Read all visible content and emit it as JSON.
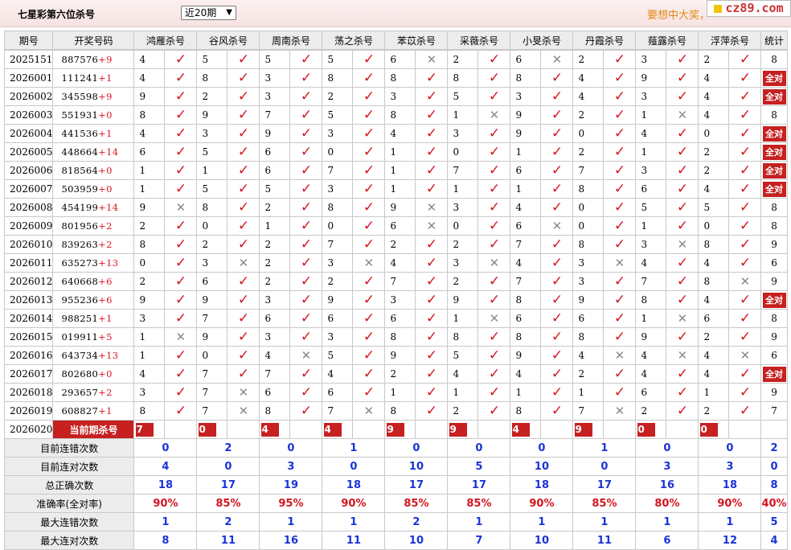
{
  "header": {
    "title": "七星彩第六位杀号",
    "period_select": "近20期",
    "marquee_text": "要想中大奖，",
    "logo_text": "cz89.com"
  },
  "columns": [
    "期号",
    "开奖号码",
    "鸿雁杀号",
    "谷风杀号",
    "周南杀号",
    "荡之杀号",
    "苯苡杀号",
    "采薇杀号",
    "小旻杀号",
    "丹霞杀号",
    "薤露杀号",
    "浮萍杀号",
    "统计"
  ],
  "rows": [
    {
      "no": "2025151",
      "num": "887576",
      "plus": "+9",
      "k": [
        [
          "4",
          1
        ],
        [
          "5",
          1
        ],
        [
          "5",
          1
        ],
        [
          "5",
          1
        ],
        [
          "6",
          0
        ],
        [
          "2",
          1
        ],
        [
          "6",
          0
        ],
        [
          "2",
          1
        ],
        [
          "3",
          1
        ],
        [
          "2",
          1
        ]
      ],
      "stat": "8"
    },
    {
      "no": "2026001",
      "num": "111241",
      "plus": "+1",
      "k": [
        [
          "4",
          1
        ],
        [
          "8",
          1
        ],
        [
          "3",
          1
        ],
        [
          "8",
          1
        ],
        [
          "8",
          1
        ],
        [
          "8",
          1
        ],
        [
          "8",
          1
        ],
        [
          "4",
          1
        ],
        [
          "9",
          1
        ],
        [
          "4",
          1
        ]
      ],
      "stat": "全对"
    },
    {
      "no": "2026002",
      "num": "345598",
      "plus": "+9",
      "k": [
        [
          "9",
          1
        ],
        [
          "2",
          1
        ],
        [
          "3",
          1
        ],
        [
          "2",
          1
        ],
        [
          "3",
          1
        ],
        [
          "5",
          1
        ],
        [
          "3",
          1
        ],
        [
          "4",
          1
        ],
        [
          "3",
          1
        ],
        [
          "4",
          1
        ]
      ],
      "stat": "全对"
    },
    {
      "no": "2026003",
      "num": "551931",
      "plus": "+0",
      "k": [
        [
          "8",
          1
        ],
        [
          "9",
          1
        ],
        [
          "7",
          1
        ],
        [
          "5",
          1
        ],
        [
          "8",
          1
        ],
        [
          "1",
          0
        ],
        [
          "9",
          1
        ],
        [
          "2",
          1
        ],
        [
          "1",
          0
        ],
        [
          "4",
          1
        ]
      ],
      "stat": "8"
    },
    {
      "no": "2026004",
      "num": "441536",
      "plus": "+1",
      "k": [
        [
          "4",
          1
        ],
        [
          "3",
          1
        ],
        [
          "9",
          1
        ],
        [
          "3",
          1
        ],
        [
          "4",
          1
        ],
        [
          "3",
          1
        ],
        [
          "9",
          1
        ],
        [
          "0",
          1
        ],
        [
          "4",
          1
        ],
        [
          "0",
          1
        ]
      ],
      "stat": "全对"
    },
    {
      "no": "2026005",
      "num": "448664",
      "plus": "+14",
      "k": [
        [
          "6",
          1
        ],
        [
          "5",
          1
        ],
        [
          "6",
          1
        ],
        [
          "0",
          1
        ],
        [
          "1",
          1
        ],
        [
          "0",
          1
        ],
        [
          "1",
          1
        ],
        [
          "2",
          1
        ],
        [
          "1",
          1
        ],
        [
          "2",
          1
        ]
      ],
      "stat": "全对"
    },
    {
      "no": "2026006",
      "num": "818564",
      "plus": "+0",
      "k": [
        [
          "1",
          1
        ],
        [
          "1",
          1
        ],
        [
          "6",
          1
        ],
        [
          "7",
          1
        ],
        [
          "1",
          1
        ],
        [
          "7",
          1
        ],
        [
          "6",
          1
        ],
        [
          "7",
          1
        ],
        [
          "3",
          1
        ],
        [
          "2",
          1
        ]
      ],
      "stat": "全对"
    },
    {
      "no": "2026007",
      "num": "503959",
      "plus": "+0",
      "k": [
        [
          "1",
          1
        ],
        [
          "5",
          1
        ],
        [
          "5",
          1
        ],
        [
          "3",
          1
        ],
        [
          "1",
          1
        ],
        [
          "1",
          1
        ],
        [
          "1",
          1
        ],
        [
          "8",
          1
        ],
        [
          "6",
          1
        ],
        [
          "4",
          1
        ]
      ],
      "stat": "全对"
    },
    {
      "no": "2026008",
      "num": "454199",
      "plus": "+14",
      "k": [
        [
          "9",
          0
        ],
        [
          "8",
          1
        ],
        [
          "2",
          1
        ],
        [
          "8",
          1
        ],
        [
          "9",
          0
        ],
        [
          "3",
          1
        ],
        [
          "4",
          1
        ],
        [
          "0",
          1
        ],
        [
          "5",
          1
        ],
        [
          "5",
          1
        ]
      ],
      "stat": "8"
    },
    {
      "no": "2026009",
      "num": "801956",
      "plus": "+2",
      "k": [
        [
          "2",
          1
        ],
        [
          "0",
          1
        ],
        [
          "1",
          1
        ],
        [
          "0",
          1
        ],
        [
          "6",
          0
        ],
        [
          "0",
          1
        ],
        [
          "6",
          0
        ],
        [
          "0",
          1
        ],
        [
          "1",
          1
        ],
        [
          "0",
          1
        ]
      ],
      "stat": "8"
    },
    {
      "no": "2026010",
      "num": "839263",
      "plus": "+2",
      "k": [
        [
          "8",
          1
        ],
        [
          "2",
          1
        ],
        [
          "2",
          1
        ],
        [
          "7",
          1
        ],
        [
          "2",
          1
        ],
        [
          "2",
          1
        ],
        [
          "7",
          1
        ],
        [
          "8",
          1
        ],
        [
          "3",
          0
        ],
        [
          "8",
          1
        ]
      ],
      "stat": "9"
    },
    {
      "no": "2026011",
      "num": "635273",
      "plus": "+13",
      "k": [
        [
          "0",
          1
        ],
        [
          "3",
          0
        ],
        [
          "2",
          1
        ],
        [
          "3",
          0
        ],
        [
          "4",
          1
        ],
        [
          "3",
          0
        ],
        [
          "4",
          1
        ],
        [
          "3",
          0
        ],
        [
          "4",
          1
        ],
        [
          "4",
          1
        ]
      ],
      "stat": "6"
    },
    {
      "no": "2026012",
      "num": "640668",
      "plus": "+6",
      "k": [
        [
          "2",
          1
        ],
        [
          "6",
          1
        ],
        [
          "2",
          1
        ],
        [
          "2",
          1
        ],
        [
          "7",
          1
        ],
        [
          "2",
          1
        ],
        [
          "7",
          1
        ],
        [
          "3",
          1
        ],
        [
          "7",
          1
        ],
        [
          "8",
          0
        ]
      ],
      "stat": "9"
    },
    {
      "no": "2026013",
      "num": "955236",
      "plus": "+6",
      "k": [
        [
          "9",
          1
        ],
        [
          "9",
          1
        ],
        [
          "3",
          1
        ],
        [
          "9",
          1
        ],
        [
          "3",
          1
        ],
        [
          "9",
          1
        ],
        [
          "8",
          1
        ],
        [
          "9",
          1
        ],
        [
          "8",
          1
        ],
        [
          "4",
          1
        ]
      ],
      "stat": "全对"
    },
    {
      "no": "2026014",
      "num": "988251",
      "plus": "+1",
      "k": [
        [
          "3",
          1
        ],
        [
          "7",
          1
        ],
        [
          "6",
          1
        ],
        [
          "6",
          1
        ],
        [
          "6",
          1
        ],
        [
          "1",
          0
        ],
        [
          "6",
          1
        ],
        [
          "6",
          1
        ],
        [
          "1",
          0
        ],
        [
          "6",
          1
        ]
      ],
      "stat": "8"
    },
    {
      "no": "2026015",
      "num": "019911",
      "plus": "+5",
      "k": [
        [
          "1",
          0
        ],
        [
          "9",
          1
        ],
        [
          "3",
          1
        ],
        [
          "3",
          1
        ],
        [
          "8",
          1
        ],
        [
          "8",
          1
        ],
        [
          "8",
          1
        ],
        [
          "8",
          1
        ],
        [
          "9",
          1
        ],
        [
          "2",
          1
        ]
      ],
      "stat": "9"
    },
    {
      "no": "2026016",
      "num": "643734",
      "plus": "+13",
      "k": [
        [
          "1",
          1
        ],
        [
          "0",
          1
        ],
        [
          "4",
          0
        ],
        [
          "5",
          1
        ],
        [
          "9",
          1
        ],
        [
          "5",
          1
        ],
        [
          "9",
          1
        ],
        [
          "4",
          0
        ],
        [
          "4",
          0
        ],
        [
          "4",
          0
        ]
      ],
      "stat": "6"
    },
    {
      "no": "2026017",
      "num": "802680",
      "plus": "+0",
      "k": [
        [
          "4",
          1
        ],
        [
          "7",
          1
        ],
        [
          "7",
          1
        ],
        [
          "4",
          1
        ],
        [
          "2",
          1
        ],
        [
          "4",
          1
        ],
        [
          "4",
          1
        ],
        [
          "2",
          1
        ],
        [
          "4",
          1
        ],
        [
          "4",
          1
        ]
      ],
      "stat": "全对"
    },
    {
      "no": "2026018",
      "num": "293657",
      "plus": "+2",
      "k": [
        [
          "3",
          1
        ],
        [
          "7",
          0
        ],
        [
          "6",
          1
        ],
        [
          "6",
          1
        ],
        [
          "1",
          1
        ],
        [
          "1",
          1
        ],
        [
          "1",
          1
        ],
        [
          "1",
          1
        ],
        [
          "6",
          1
        ],
        [
          "1",
          1
        ]
      ],
      "stat": "9"
    },
    {
      "no": "2026019",
      "num": "608827",
      "plus": "+1",
      "k": [
        [
          "8",
          1
        ],
        [
          "7",
          0
        ],
        [
          "8",
          1
        ],
        [
          "7",
          0
        ],
        [
          "8",
          1
        ],
        [
          "2",
          1
        ],
        [
          "8",
          1
        ],
        [
          "7",
          0
        ],
        [
          "2",
          1
        ],
        [
          "2",
          1
        ]
      ],
      "stat": "7"
    }
  ],
  "current": {
    "no": "2026020",
    "label": "当前期杀号",
    "k": [
      "7",
      "0",
      "4",
      "4",
      "9",
      "9",
      "4",
      "9",
      "0",
      "0"
    ]
  },
  "stats": [
    {
      "label": "目前连错次数",
      "vals": [
        "0",
        "2",
        "0",
        "1",
        "0",
        "0",
        "0",
        "1",
        "0",
        "0",
        "2"
      ],
      "red": false
    },
    {
      "label": "目前连对次数",
      "vals": [
        "4",
        "0",
        "3",
        "0",
        "10",
        "5",
        "10",
        "0",
        "3",
        "3",
        "0"
      ],
      "red": false
    },
    {
      "label": "总正确次数",
      "vals": [
        "18",
        "17",
        "19",
        "18",
        "17",
        "17",
        "18",
        "17",
        "16",
        "18",
        "8"
      ],
      "red": false
    },
    {
      "label": "准确率(全对率)",
      "vals": [
        "90%",
        "85%",
        "95%",
        "90%",
        "85%",
        "85%",
        "90%",
        "85%",
        "80%",
        "90%",
        "40%"
      ],
      "red": true
    },
    {
      "label": "最大连错次数",
      "vals": [
        "1",
        "2",
        "1",
        "1",
        "2",
        "1",
        "1",
        "1",
        "1",
        "1",
        "5"
      ],
      "red": false
    },
    {
      "label": "最大连对次数",
      "vals": [
        "8",
        "11",
        "16",
        "11",
        "10",
        "7",
        "10",
        "11",
        "6",
        "12",
        "4"
      ],
      "red": false
    }
  ],
  "icons": {
    "correct": "check-icon",
    "wrong": "cross-icon"
  },
  "colors": {
    "accent_red": "#c62020",
    "stat_blue": "#1a33d6",
    "marquee_orange": "#e08a12"
  }
}
